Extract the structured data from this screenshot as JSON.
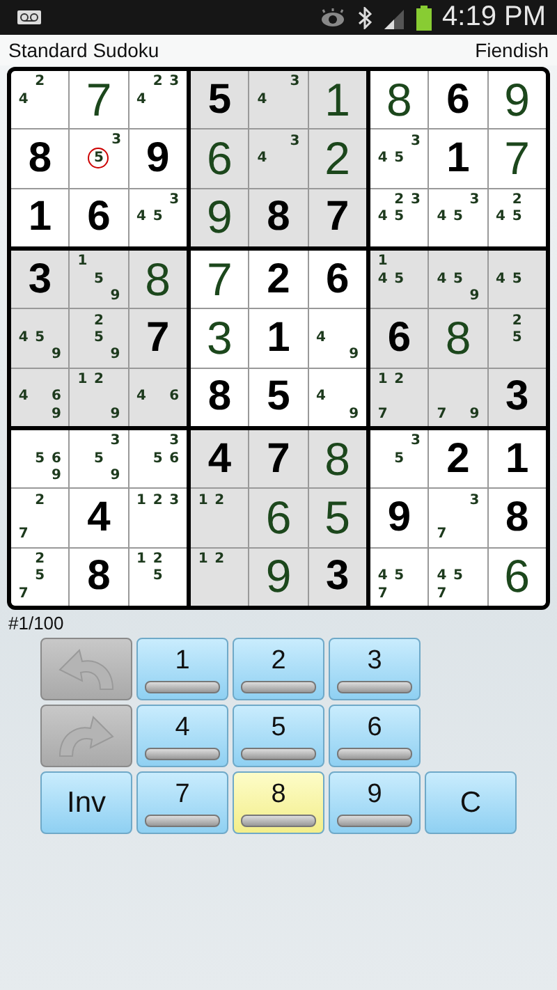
{
  "status_bar": {
    "time": "4:19 PM"
  },
  "header": {
    "title": "Standard Sudoku",
    "difficulty": "Fiendish"
  },
  "grid": {
    "rows": [
      [
        {
          "kind": "notes",
          "notes": [
            {
              "digit": "2",
              "circled": false
            },
            {
              "digit": "4",
              "circled": false
            }
          ]
        },
        {
          "kind": "entered",
          "value": "7"
        },
        {
          "kind": "notes",
          "notes": [
            {
              "digit": "2",
              "circled": false
            },
            {
              "digit": "3",
              "circled": false
            },
            {
              "digit": "4",
              "circled": false
            }
          ]
        },
        {
          "kind": "given",
          "value": "5"
        },
        {
          "kind": "notes",
          "notes": [
            {
              "digit": "3",
              "circled": false
            },
            {
              "digit": "4",
              "circled": false
            }
          ]
        },
        {
          "kind": "entered",
          "value": "1"
        },
        {
          "kind": "entered",
          "value": "8"
        },
        {
          "kind": "given",
          "value": "6"
        },
        {
          "kind": "entered",
          "value": "9"
        }
      ],
      [
        {
          "kind": "given",
          "value": "8"
        },
        {
          "kind": "notes",
          "notes": [
            {
              "digit": "3",
              "circled": false
            },
            {
              "digit": "5",
              "circled": true
            }
          ]
        },
        {
          "kind": "given",
          "value": "9"
        },
        {
          "kind": "entered",
          "value": "6"
        },
        {
          "kind": "notes",
          "notes": [
            {
              "digit": "3",
              "circled": false
            },
            {
              "digit": "4",
              "circled": false
            }
          ]
        },
        {
          "kind": "entered",
          "value": "2"
        },
        {
          "kind": "notes",
          "notes": [
            {
              "digit": "3",
              "circled": false
            },
            {
              "digit": "4",
              "circled": false
            },
            {
              "digit": "5",
              "circled": false
            }
          ]
        },
        {
          "kind": "given",
          "value": "1"
        },
        {
          "kind": "entered",
          "value": "7"
        }
      ],
      [
        {
          "kind": "given",
          "value": "1"
        },
        {
          "kind": "given",
          "value": "6"
        },
        {
          "kind": "notes",
          "notes": [
            {
              "digit": "3",
              "circled": false
            },
            {
              "digit": "4",
              "circled": false
            },
            {
              "digit": "5",
              "circled": false
            }
          ]
        },
        {
          "kind": "entered",
          "value": "9"
        },
        {
          "kind": "given",
          "value": "8"
        },
        {
          "kind": "given",
          "value": "7"
        },
        {
          "kind": "notes",
          "notes": [
            {
              "digit": "2",
              "circled": false
            },
            {
              "digit": "3",
              "circled": false
            },
            {
              "digit": "4",
              "circled": false
            },
            {
              "digit": "5",
              "circled": false
            }
          ]
        },
        {
          "kind": "notes",
          "notes": [
            {
              "digit": "3",
              "circled": false
            },
            {
              "digit": "4",
              "circled": false
            },
            {
              "digit": "5",
              "circled": false
            }
          ]
        },
        {
          "kind": "notes",
          "notes": [
            {
              "digit": "2",
              "circled": false
            },
            {
              "digit": "4",
              "circled": false
            },
            {
              "digit": "5",
              "circled": false
            }
          ]
        }
      ],
      [
        {
          "kind": "given",
          "value": "3"
        },
        {
          "kind": "notes",
          "notes": [
            {
              "digit": "1",
              "circled": false
            },
            {
              "digit": "5",
              "circled": false
            },
            {
              "digit": "9",
              "circled": false
            }
          ]
        },
        {
          "kind": "entered",
          "value": "8"
        },
        {
          "kind": "entered",
          "value": "7"
        },
        {
          "kind": "given",
          "value": "2"
        },
        {
          "kind": "given",
          "value": "6"
        },
        {
          "kind": "notes",
          "notes": [
            {
              "digit": "1",
              "circled": false
            },
            {
              "digit": "4",
              "circled": false
            },
            {
              "digit": "5",
              "circled": false
            }
          ]
        },
        {
          "kind": "notes",
          "notes": [
            {
              "digit": "4",
              "circled": false
            },
            {
              "digit": "5",
              "circled": false
            },
            {
              "digit": "9",
              "circled": false
            }
          ]
        },
        {
          "kind": "notes",
          "notes": [
            {
              "digit": "4",
              "circled": false
            },
            {
              "digit": "5",
              "circled": false
            }
          ]
        }
      ],
      [
        {
          "kind": "notes",
          "notes": [
            {
              "digit": "4",
              "circled": false
            },
            {
              "digit": "5",
              "circled": false
            },
            {
              "digit": "9",
              "circled": false
            }
          ]
        },
        {
          "kind": "notes",
          "notes": [
            {
              "digit": "2",
              "circled": false
            },
            {
              "digit": "5",
              "circled": false
            },
            {
              "digit": "9",
              "circled": false
            }
          ]
        },
        {
          "kind": "given",
          "value": "7"
        },
        {
          "kind": "entered",
          "value": "3"
        },
        {
          "kind": "given",
          "value": "1"
        },
        {
          "kind": "notes",
          "notes": [
            {
              "digit": "4",
              "circled": false
            },
            {
              "digit": "9",
              "circled": false
            }
          ]
        },
        {
          "kind": "given",
          "value": "6"
        },
        {
          "kind": "entered",
          "value": "8"
        },
        {
          "kind": "notes",
          "notes": [
            {
              "digit": "2",
              "circled": false
            },
            {
              "digit": "5",
              "circled": false
            }
          ]
        }
      ],
      [
        {
          "kind": "notes",
          "notes": [
            {
              "digit": "4",
              "circled": false
            },
            {
              "digit": "6",
              "circled": false
            },
            {
              "digit": "9",
              "circled": false
            }
          ]
        },
        {
          "kind": "notes",
          "notes": [
            {
              "digit": "1",
              "circled": false
            },
            {
              "digit": "2",
              "circled": false
            },
            {
              "digit": "9",
              "circled": false
            }
          ]
        },
        {
          "kind": "notes",
          "notes": [
            {
              "digit": "4",
              "circled": false
            },
            {
              "digit": "6",
              "circled": false
            }
          ]
        },
        {
          "kind": "given",
          "value": "8"
        },
        {
          "kind": "given",
          "value": "5"
        },
        {
          "kind": "notes",
          "notes": [
            {
              "digit": "4",
              "circled": false
            },
            {
              "digit": "9",
              "circled": false
            }
          ]
        },
        {
          "kind": "notes",
          "notes": [
            {
              "digit": "1",
              "circled": false
            },
            {
              "digit": "2",
              "circled": false
            },
            {
              "digit": "7",
              "circled": false
            }
          ]
        },
        {
          "kind": "notes",
          "notes": [
            {
              "digit": "7",
              "circled": false
            },
            {
              "digit": "9",
              "circled": false
            }
          ]
        },
        {
          "kind": "given",
          "value": "3"
        }
      ],
      [
        {
          "kind": "notes",
          "notes": [
            {
              "digit": "5",
              "circled": false
            },
            {
              "digit": "6",
              "circled": false
            },
            {
              "digit": "9",
              "circled": false
            }
          ]
        },
        {
          "kind": "notes",
          "notes": [
            {
              "digit": "3",
              "circled": false
            },
            {
              "digit": "5",
              "circled": false
            },
            {
              "digit": "9",
              "circled": false
            }
          ]
        },
        {
          "kind": "notes",
          "notes": [
            {
              "digit": "3",
              "circled": false
            },
            {
              "digit": "5",
              "circled": false
            },
            {
              "digit": "6",
              "circled": false
            }
          ]
        },
        {
          "kind": "given",
          "value": "4"
        },
        {
          "kind": "given",
          "value": "7"
        },
        {
          "kind": "entered",
          "value": "8"
        },
        {
          "kind": "notes",
          "notes": [
            {
              "digit": "3",
              "circled": false
            },
            {
              "digit": "5",
              "circled": false
            }
          ]
        },
        {
          "kind": "given",
          "value": "2"
        },
        {
          "kind": "given",
          "value": "1"
        }
      ],
      [
        {
          "kind": "notes",
          "notes": [
            {
              "digit": "2",
              "circled": false
            },
            {
              "digit": "7",
              "circled": false
            }
          ]
        },
        {
          "kind": "given",
          "value": "4"
        },
        {
          "kind": "notes",
          "notes": [
            {
              "digit": "1",
              "circled": false
            },
            {
              "digit": "2",
              "circled": false
            },
            {
              "digit": "3",
              "circled": false
            }
          ]
        },
        {
          "kind": "notes",
          "notes": [
            {
              "digit": "1",
              "circled": false
            },
            {
              "digit": "2",
              "circled": false
            }
          ]
        },
        {
          "kind": "entered",
          "value": "6"
        },
        {
          "kind": "entered",
          "value": "5"
        },
        {
          "kind": "given",
          "value": "9"
        },
        {
          "kind": "notes",
          "notes": [
            {
              "digit": "3",
              "circled": false
            },
            {
              "digit": "7",
              "circled": false
            }
          ]
        },
        {
          "kind": "given",
          "value": "8"
        }
      ],
      [
        {
          "kind": "notes",
          "notes": [
            {
              "digit": "2",
              "circled": false
            },
            {
              "digit": "5",
              "circled": false
            },
            {
              "digit": "7",
              "circled": false
            }
          ]
        },
        {
          "kind": "given",
          "value": "8"
        },
        {
          "kind": "notes",
          "notes": [
            {
              "digit": "1",
              "circled": false
            },
            {
              "digit": "2",
              "circled": false
            },
            {
              "digit": "5",
              "circled": false
            }
          ]
        },
        {
          "kind": "notes",
          "notes": [
            {
              "digit": "1",
              "circled": false
            },
            {
              "digit": "2",
              "circled": false
            }
          ]
        },
        {
          "kind": "entered",
          "value": "9"
        },
        {
          "kind": "given",
          "value": "3"
        },
        {
          "kind": "notes",
          "notes": [
            {
              "digit": "4",
              "circled": false
            },
            {
              "digit": "5",
              "circled": false
            },
            {
              "digit": "7",
              "circled": false
            }
          ]
        },
        {
          "kind": "notes",
          "notes": [
            {
              "digit": "4",
              "circled": false
            },
            {
              "digit": "5",
              "circled": false
            },
            {
              "digit": "7",
              "circled": false
            }
          ]
        },
        {
          "kind": "entered",
          "value": "6"
        }
      ]
    ]
  },
  "puzzle_counter": "#1/100",
  "keypad": {
    "rows": [
      [
        {
          "kind": "undo",
          "disabled": true
        },
        {
          "kind": "digit",
          "label": "1",
          "selected": false
        },
        {
          "kind": "digit",
          "label": "2",
          "selected": false
        },
        {
          "kind": "digit",
          "label": "3",
          "selected": false
        }
      ],
      [
        {
          "kind": "redo",
          "disabled": true
        },
        {
          "kind": "digit",
          "label": "4",
          "selected": false
        },
        {
          "kind": "digit",
          "label": "5",
          "selected": false
        },
        {
          "kind": "digit",
          "label": "6",
          "selected": false
        }
      ],
      [
        {
          "kind": "text",
          "label": "Inv"
        },
        {
          "kind": "digit",
          "label": "7",
          "selected": false
        },
        {
          "kind": "digit",
          "label": "8",
          "selected": true
        },
        {
          "kind": "digit",
          "label": "9",
          "selected": false
        },
        {
          "kind": "text",
          "label": "C"
        }
      ]
    ]
  }
}
